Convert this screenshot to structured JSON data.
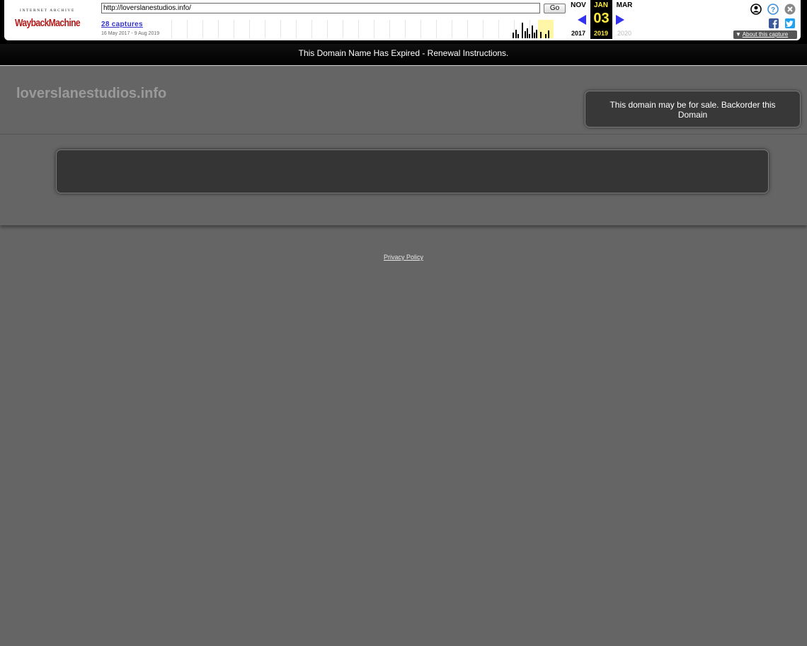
{
  "wayback": {
    "logo": {
      "top_text": "INTERNET ARCHIVE",
      "brand_text": "WaybackMachine"
    },
    "url_value": "http://loverslanestudios.info/",
    "go_label": "Go",
    "captures_label": "28 captures",
    "captures_range": "16 May 2017 - 9 Aug 2019",
    "calendar": {
      "prev_month": "NOV",
      "current_month": "JAN",
      "next_month": "MAR",
      "current_day": "03",
      "prev_year": "2017",
      "current_year": "2019",
      "next_year": "2020"
    },
    "about_label": "About this capture",
    "icons": [
      "user-icon",
      "help-icon",
      "close-icon",
      "facebook-icon",
      "twitter-icon",
      "prev-capture-arrow-icon",
      "next-capture-arrow-icon"
    ]
  },
  "banner": {
    "text": "This Domain Name Has Expired - Renewal Instructions."
  },
  "site": {
    "title": "loverslanestudios.info",
    "sale_text": "This domain may be for sale. Backorder this Domain"
  },
  "footer": {
    "privacy_label": "Privacy Policy"
  },
  "colors": {
    "page_background": "#656565",
    "banner_background": "#000000",
    "box_background": "#353535",
    "calendar_highlight": "#ffeb3b",
    "link_blue": "#3333cc"
  }
}
